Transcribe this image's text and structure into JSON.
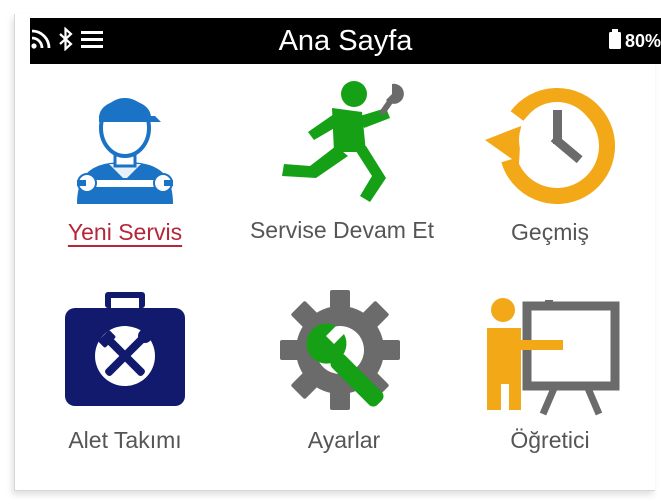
{
  "status_bar": {
    "title": "Ana Sayfa",
    "battery_text": "80%",
    "icons": [
      "wifi-icon",
      "bluetooth-icon",
      "menu-icon",
      "battery-icon"
    ]
  },
  "colors": {
    "status_bar_bg": "#000000",
    "selected_label": "#b5263a",
    "label": "#555555",
    "green": "#16a016",
    "orange": "#f2a817",
    "blue": "#1a73c4",
    "navy": "#121a6e",
    "gray": "#6b6b6b"
  },
  "menu": {
    "selected": "Yeni Servis",
    "items": [
      {
        "label": "Yeni Servis",
        "icon": "mechanic-icon"
      },
      {
        "label": "Servise Devam Et",
        "icon": "running-mechanic-icon"
      },
      {
        "label": "Geçmiş",
        "icon": "history-clock-icon"
      },
      {
        "label": "Alet Takımı",
        "icon": "toolbox-icon"
      },
      {
        "label": "Ayarlar",
        "icon": "settings-gear-icon"
      },
      {
        "label": "Öğretici",
        "icon": "tutorial-icon"
      }
    ]
  }
}
